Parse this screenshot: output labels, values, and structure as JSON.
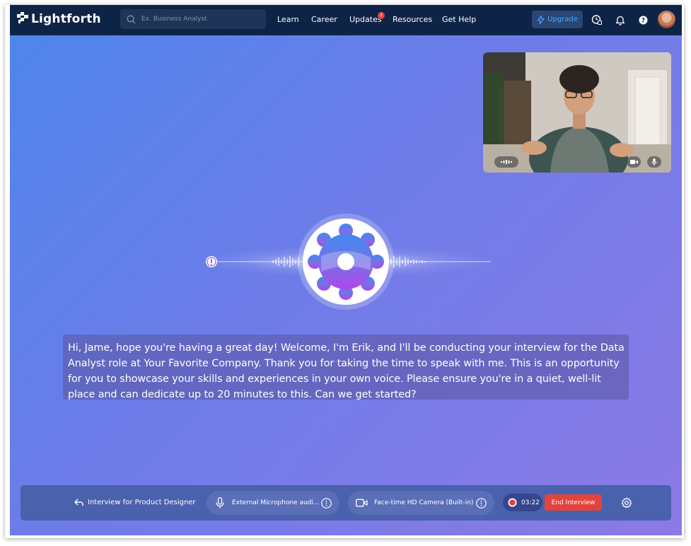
{
  "brand": {
    "name": "Lightforth"
  },
  "search": {
    "placeholder": "Ex. Business Analyst"
  },
  "nav": {
    "items": [
      "Learn",
      "Career",
      "Updates",
      "Resources",
      "Get Help"
    ],
    "updates_badge": "2"
  },
  "header": {
    "upgrade_label": "Upgrade"
  },
  "transcript": {
    "text": "Hi, Jame, hope you're having a great day! Welcome, I'm Erik, and I'll be conducting your interview for the Data Analyst role at Your Favorite Company. Thank you for taking the time to speak with me. This is an opportunity for you to showcase your skills and experiences in your own voice. Please ensure you're in a quiet, well-lit place and can dedicate up to 20 minutes to this. Can we get started?"
  },
  "controls": {
    "back_label": "Interview for Product Designer",
    "microphone": "External Microphone audi...",
    "camera": "Face-time HD Camera (Built-in)",
    "timer": "03:22",
    "end_label": "End Interview"
  },
  "colors": {
    "topbar": "#0e2447",
    "accent": "#4ea6ff",
    "end_button": "#e2443b",
    "bottom_bar": "#4a61ad"
  }
}
